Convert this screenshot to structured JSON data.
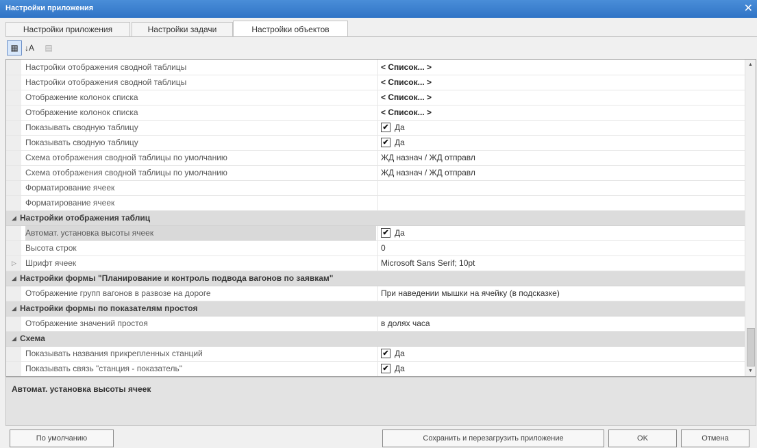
{
  "window": {
    "title": "Настройки приложения",
    "close_glyph": "✕"
  },
  "tabs": [
    {
      "label": "Настройки приложения"
    },
    {
      "label": "Настройки задачи"
    },
    {
      "label": "Настройки объектов"
    }
  ],
  "active_tab": 2,
  "toolbar": {
    "categorized_icon": "categorized-icon",
    "categorized_glyph": "▦",
    "alphabetical_icon": "sort-alphabetical-icon",
    "alphabetical_glyph": "↓A",
    "pages_icon": "property-pages-icon",
    "pages_glyph": "▤"
  },
  "grid": {
    "rows": [
      {
        "type": "prop",
        "name": "Настройки отображения сводной таблицы",
        "value": "< Список... >",
        "value_kind": "list"
      },
      {
        "type": "prop",
        "name": "Настройки отображения сводной таблицы",
        "value": "< Список... >",
        "value_kind": "list"
      },
      {
        "type": "prop",
        "name": "Отображение колонок списка",
        "value": "< Список... >",
        "value_kind": "list"
      },
      {
        "type": "prop",
        "name": "Отображение колонок списка",
        "value": "< Список... >",
        "value_kind": "list"
      },
      {
        "type": "prop",
        "name": "Показывать сводную таблицу",
        "value": "Да",
        "value_kind": "checkbox",
        "checked": true
      },
      {
        "type": "prop",
        "name": "Показывать сводную таблицу",
        "value": "Да",
        "value_kind": "checkbox",
        "checked": true
      },
      {
        "type": "prop",
        "name": "Схема отображения сводной таблицы по умолчанию",
        "value": "ЖД назнач / ЖД отправл",
        "value_kind": "text"
      },
      {
        "type": "prop",
        "name": "Схема отображения сводной таблицы по умолчанию",
        "value": "ЖД назнач / ЖД отправл",
        "value_kind": "text"
      },
      {
        "type": "prop",
        "name": "Форматирование ячеек",
        "value": "",
        "value_kind": "text"
      },
      {
        "type": "prop",
        "name": "Форматирование ячеек",
        "value": "",
        "value_kind": "text"
      },
      {
        "type": "category",
        "name": "Настройки отображения таблиц",
        "expanded": true
      },
      {
        "type": "prop",
        "name": "Автомат. установка высоты ячеек",
        "value": "Да",
        "value_kind": "checkbox",
        "checked": true,
        "selected": true
      },
      {
        "type": "prop",
        "name": "Высота строк",
        "value": "0",
        "value_kind": "text"
      },
      {
        "type": "prop",
        "name": "Шрифт ячеек",
        "value": "Microsoft Sans Serif; 10pt",
        "value_kind": "text",
        "expandable": true
      },
      {
        "type": "category",
        "name": "Настройки формы \"Планирование и контроль подвода вагонов по заявкам\"",
        "expanded": true
      },
      {
        "type": "prop",
        "name": "Отображение групп вагонов в развозе на дороге",
        "value": "При наведении мышки на ячейку (в подсказке)",
        "value_kind": "text"
      },
      {
        "type": "category",
        "name": "Настройки формы по показателям простоя",
        "expanded": true
      },
      {
        "type": "prop",
        "name": "Отображение значений простоя",
        "value": "в долях часа",
        "value_kind": "text"
      },
      {
        "type": "category",
        "name": "Схема",
        "expanded": true
      },
      {
        "type": "prop",
        "name": "Показывать названия прикрепленных станций",
        "value": "Да",
        "value_kind": "checkbox",
        "checked": true
      },
      {
        "type": "prop",
        "name": "Показывать связь \"станция - показатель\"",
        "value": "Да",
        "value_kind": "checkbox",
        "checked": true
      }
    ],
    "scrollbar": {
      "up_glyph": "▲",
      "down_glyph": "▼"
    }
  },
  "description": {
    "title": "Автомат. установка высоты ячеек"
  },
  "buttons": {
    "defaults": "По умолчанию",
    "save_restart": "Сохранить и перезагрузить приложение",
    "ok": "OK",
    "cancel": "Отмена"
  },
  "glyphs": {
    "expanded": "◢",
    "collapsed": "▷",
    "check": "✔"
  },
  "colors": {
    "titlebar": "#2f74c6",
    "category_bg": "#dcdcdc",
    "selected_bg": "#d9d9d9"
  }
}
